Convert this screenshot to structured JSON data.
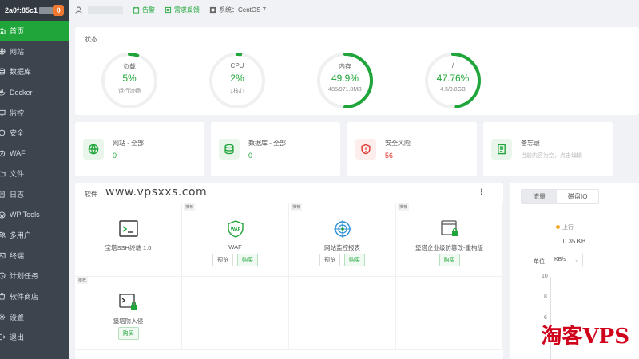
{
  "sidebar": {
    "brand": "2a0f:85c1",
    "badge": "0",
    "items": [
      {
        "label": "首页",
        "icon": "home-icon",
        "active": true
      },
      {
        "label": "网站",
        "icon": "globe-icon"
      },
      {
        "label": "数据库",
        "icon": "database-icon"
      },
      {
        "label": "Docker",
        "icon": "docker-icon"
      },
      {
        "label": "监控",
        "icon": "monitor-icon"
      },
      {
        "label": "安全",
        "icon": "shield-icon"
      },
      {
        "label": "WAF",
        "icon": "waf-icon"
      },
      {
        "label": "文件",
        "icon": "folder-icon"
      },
      {
        "label": "日志",
        "icon": "log-icon"
      },
      {
        "label": "WP Tools",
        "icon": "wordpress-icon"
      },
      {
        "label": "多用户",
        "icon": "users-icon"
      },
      {
        "label": "终端",
        "icon": "terminal-icon"
      },
      {
        "label": "计划任务",
        "icon": "clock-icon"
      },
      {
        "label": "软件商店",
        "icon": "store-icon"
      },
      {
        "label": "设置",
        "icon": "gear-icon"
      },
      {
        "label": "退出",
        "icon": "logout-icon"
      }
    ]
  },
  "topbar": {
    "alarm": "告警",
    "feedback": "需求反馈",
    "system": "系统：CentOS 7"
  },
  "status": {
    "title": "状态",
    "gauges": [
      {
        "label": "负载",
        "value": "5%",
        "sub": "运行流畅",
        "percent": 5
      },
      {
        "label": "CPU",
        "value": "2%",
        "sub": "1核心",
        "percent": 2
      },
      {
        "label": "内存",
        "value": "49.9%",
        "sub": "485/971.8MB",
        "percent": 49.9
      },
      {
        "label": "/",
        "value": "47.76%",
        "sub": "4.5/9.8GB",
        "percent": 47.76
      }
    ]
  },
  "info": [
    {
      "title": "网站 - 全部",
      "value": "0",
      "icon": "globe-icon"
    },
    {
      "title": "数据库 - 全部",
      "value": "0",
      "icon": "database-icon"
    },
    {
      "title": "安全风险",
      "value": "56",
      "icon": "shield-alert-icon"
    },
    {
      "title": "备忘录",
      "value": "当前内容为空，点击编辑",
      "icon": "memo-icon"
    }
  ],
  "software": {
    "title": "软件",
    "watermark": "www.vpsxxs.com",
    "items": [
      {
        "name": "宝塔SSH终端 1.0",
        "tag": "",
        "icon": "terminal-icon",
        "buttons": []
      },
      {
        "name": "WAF",
        "tag": "推荐",
        "icon": "waf-icon",
        "buttons": [
          "预览",
          "购买"
        ]
      },
      {
        "name": "网站监控报表",
        "tag": "推荐",
        "icon": "monitor-report-icon",
        "buttons": [
          "预览",
          "购买"
        ]
      },
      {
        "name": "堡塔企业级防篡改-重构版",
        "tag": "推荐",
        "icon": "tamper-proof-icon",
        "buttons": [
          "购买"
        ]
      },
      {
        "name": "堡塔防入侵",
        "tag": "推荐",
        "icon": "intrusion-icon",
        "buttons": [
          "购买"
        ]
      }
    ]
  },
  "traffic": {
    "tabs": [
      "流量",
      "磁盘IO"
    ],
    "legend_up": "上行",
    "rate": "0.35 KB",
    "unit_label": "单位",
    "unit_value": "KB/s",
    "ticks": [
      "10",
      "8",
      "6"
    ]
  },
  "corner_watermark": "淘客VPS",
  "colors": {
    "accent": "#20a53a",
    "danger": "#e0362e",
    "sidebar": "#3c444d"
  }
}
